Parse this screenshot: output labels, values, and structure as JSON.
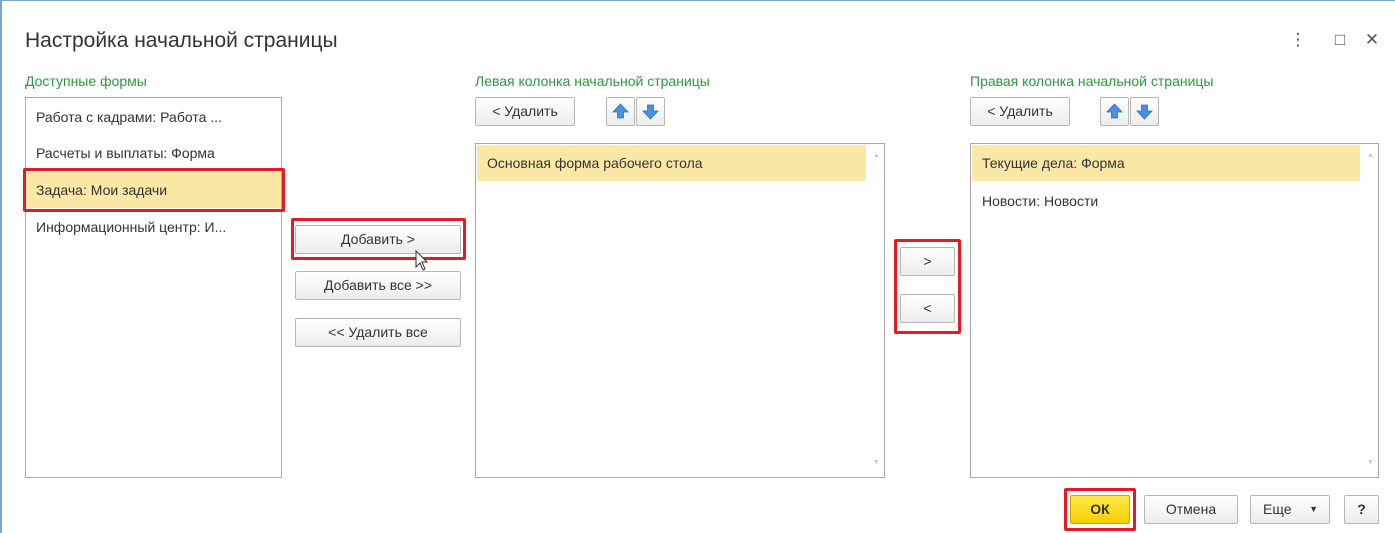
{
  "window": {
    "title": "Настройка начальной страницы",
    "controls": {
      "menu": "⋮",
      "maximize": "□",
      "close": "✕"
    }
  },
  "available": {
    "label": "Доступные формы",
    "items": [
      {
        "label": "Работа с кадрами: Работа ..."
      },
      {
        "label": "Расчеты и выплаты: Форма"
      },
      {
        "label": "Задача: Мои задачи",
        "selected": true
      },
      {
        "label": "Информационный центр: И..."
      }
    ]
  },
  "middle_buttons": {
    "add": "Добавить >",
    "add_all": "Добавить все >>",
    "remove_all": "<< Удалить все"
  },
  "left_column": {
    "label": "Левая колонка начальной страницы",
    "delete_label": "< Удалить",
    "items": [
      {
        "label": "Основная форма рабочего стола",
        "selected": true
      }
    ]
  },
  "move_buttons": {
    "to_right": ">",
    "to_left": "<"
  },
  "right_column": {
    "label": "Правая колонка начальной страницы",
    "delete_label": "< Удалить",
    "items": [
      {
        "label": "Текущие дела: Форма",
        "selected": true
      },
      {
        "label": "Новости: Новости"
      }
    ]
  },
  "footer": {
    "ok": "ОК",
    "cancel": "Отмена",
    "more": "Еще",
    "help": "?"
  },
  "colors": {
    "section_label": "#2a9a3a",
    "selection": "#fbe8a6",
    "highlight": "#e31b23",
    "primary": "#f5cf00",
    "arrow_icon": "#4a90e2"
  },
  "icons": {
    "move_up": "arrow-up-icon",
    "move_down": "arrow-down-icon",
    "more_dropdown": "caret-down-icon",
    "cursor": "mouse-pointer-icon"
  }
}
